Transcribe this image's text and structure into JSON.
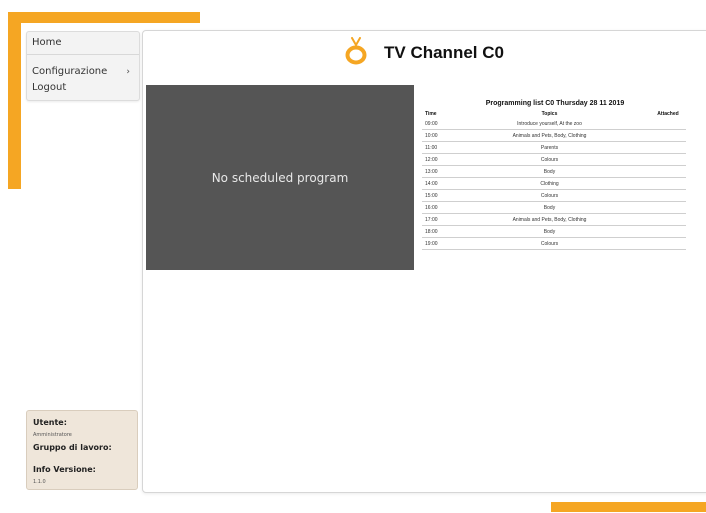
{
  "sidebar": {
    "items": [
      {
        "label": "Home"
      },
      {
        "label": "Configurazione"
      },
      {
        "label": "Logout"
      }
    ],
    "chevron": "›"
  },
  "info": {
    "user_label": "Utente:",
    "user_value": "Amministratore",
    "group_label": "Gruppo di lavoro:",
    "group_value": "",
    "version_label": "Info Versione:",
    "version_value": "1.1.0"
  },
  "header": {
    "title": "TV Channel C0",
    "logo_icon": "tv-icon",
    "accent_color": "#f5a623"
  },
  "player": {
    "message": "No scheduled program"
  },
  "schedule": {
    "title": "Programming list C0 Thursday 28 11 2019",
    "columns": [
      "Time",
      "Topics",
      "Attached"
    ],
    "rows": [
      {
        "time": "09:00",
        "topics": "Introduce yourself, At the zoo",
        "attached": ""
      },
      {
        "time": "10:00",
        "topics": "Animals and Pets, Body, Clothing",
        "attached": ""
      },
      {
        "time": "11:00",
        "topics": "Parents",
        "attached": ""
      },
      {
        "time": "12:00",
        "topics": "Colours",
        "attached": ""
      },
      {
        "time": "13:00",
        "topics": "Body",
        "attached": ""
      },
      {
        "time": "14:00",
        "topics": "Clothing",
        "attached": ""
      },
      {
        "time": "15:00",
        "topics": "Colours",
        "attached": ""
      },
      {
        "time": "16:00",
        "topics": "Body",
        "attached": ""
      },
      {
        "time": "17:00",
        "topics": "Animals and Pets, Body, Clothing",
        "attached": ""
      },
      {
        "time": "18:00",
        "topics": "Body",
        "attached": ""
      },
      {
        "time": "19:00",
        "topics": "Colours",
        "attached": ""
      }
    ]
  }
}
